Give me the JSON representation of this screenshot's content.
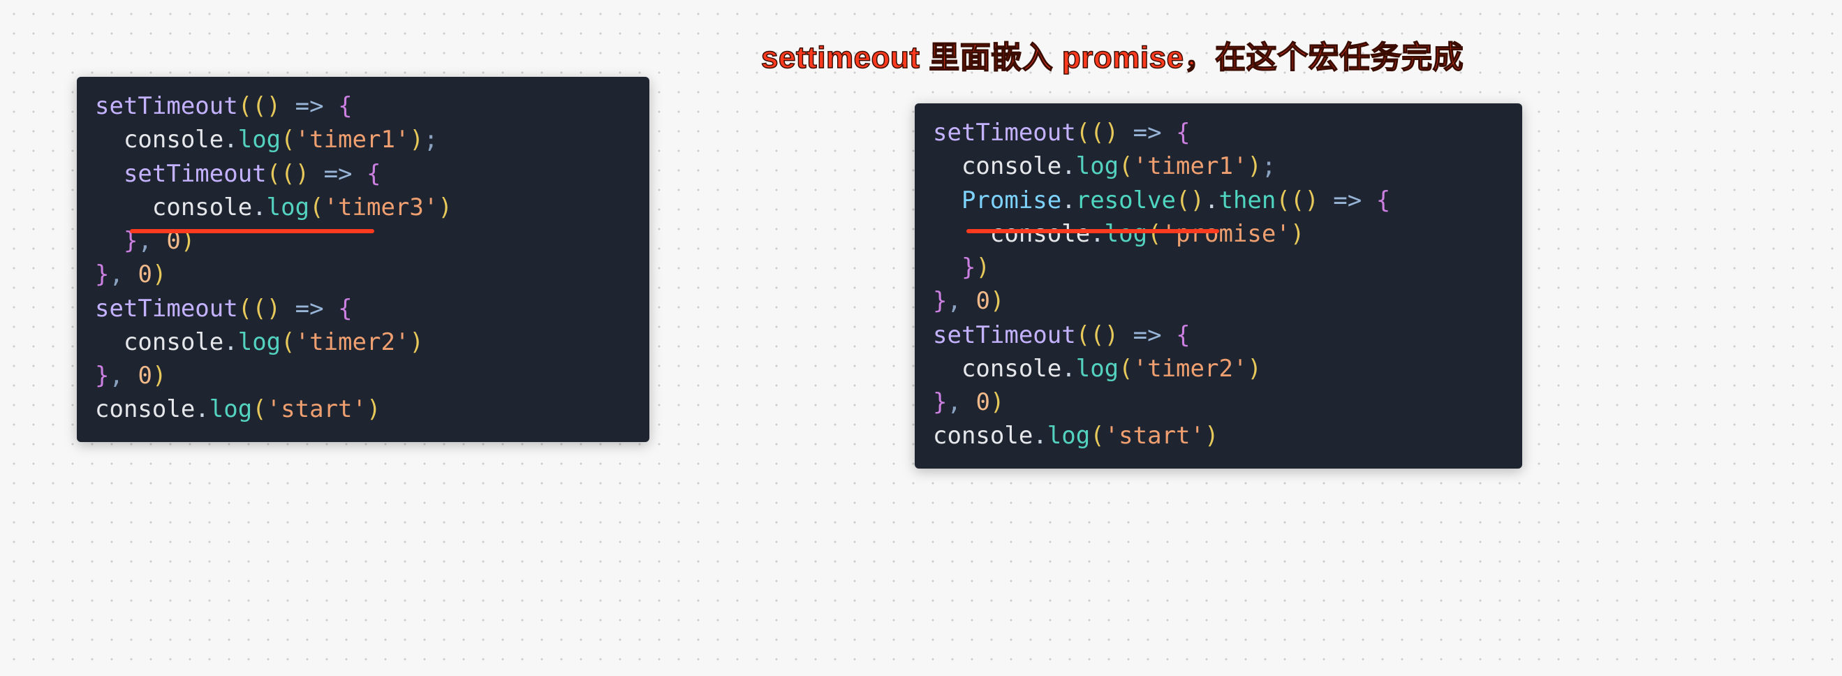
{
  "annotation": "settimeout 里面嵌入 promise，在这个宏任务完成",
  "left_code": {
    "lines": [
      [
        {
          "t": "setTimeout",
          "c": "fn"
        },
        {
          "t": "(",
          "c": "prn"
        },
        {
          "t": "()",
          "c": "prn"
        },
        {
          "t": " "
        },
        {
          "t": "=>",
          "c": "arw"
        },
        {
          "t": " "
        },
        {
          "t": "{",
          "c": "cb"
        }
      ],
      [
        {
          "t": "  "
        },
        {
          "t": "console",
          "c": "obj"
        },
        {
          "t": ".",
          "c": "dot"
        },
        {
          "t": "log",
          "c": "mtd"
        },
        {
          "t": "(",
          "c": "prn"
        },
        {
          "t": "'timer1'",
          "c": "str"
        },
        {
          "t": ")",
          "c": "prn"
        },
        {
          "t": ";",
          "c": "op"
        }
      ],
      [
        {
          "t": "  "
        },
        {
          "t": "setTimeout",
          "c": "fn"
        },
        {
          "t": "(",
          "c": "prn"
        },
        {
          "t": "()",
          "c": "prn"
        },
        {
          "t": " "
        },
        {
          "t": "=>",
          "c": "arw"
        },
        {
          "t": " "
        },
        {
          "t": "{",
          "c": "cb"
        }
      ],
      [
        {
          "t": "    "
        },
        {
          "t": "console",
          "c": "obj"
        },
        {
          "t": ".",
          "c": "dot"
        },
        {
          "t": "log",
          "c": "mtd"
        },
        {
          "t": "(",
          "c": "prn"
        },
        {
          "t": "'timer3'",
          "c": "str"
        },
        {
          "t": ")",
          "c": "prn"
        }
      ],
      [
        {
          "t": "  "
        },
        {
          "t": "}",
          "c": "cb"
        },
        {
          "t": ",",
          "c": "op"
        },
        {
          "t": " "
        },
        {
          "t": "0",
          "c": "num"
        },
        {
          "t": ")",
          "c": "prn"
        }
      ],
      [
        {
          "t": "}",
          "c": "cb"
        },
        {
          "t": ",",
          "c": "op"
        },
        {
          "t": " "
        },
        {
          "t": "0",
          "c": "num"
        },
        {
          "t": ")",
          "c": "prn"
        }
      ],
      [
        {
          "t": "setTimeout",
          "c": "fn"
        },
        {
          "t": "(",
          "c": "prn"
        },
        {
          "t": "()",
          "c": "prn"
        },
        {
          "t": " "
        },
        {
          "t": "=>",
          "c": "arw"
        },
        {
          "t": " "
        },
        {
          "t": "{",
          "c": "cb"
        }
      ],
      [
        {
          "t": "  "
        },
        {
          "t": "console",
          "c": "obj"
        },
        {
          "t": ".",
          "c": "dot"
        },
        {
          "t": "log",
          "c": "mtd"
        },
        {
          "t": "(",
          "c": "prn"
        },
        {
          "t": "'timer2'",
          "c": "str"
        },
        {
          "t": ")",
          "c": "prn"
        }
      ],
      [
        {
          "t": "}",
          "c": "cb"
        },
        {
          "t": ",",
          "c": "op"
        },
        {
          "t": " "
        },
        {
          "t": "0",
          "c": "num"
        },
        {
          "t": ")",
          "c": "prn"
        }
      ],
      [
        {
          "t": "console",
          "c": "obj"
        },
        {
          "t": ".",
          "c": "dot"
        },
        {
          "t": "log",
          "c": "mtd"
        },
        {
          "t": "(",
          "c": "prn"
        },
        {
          "t": "'start'",
          "c": "str"
        },
        {
          "t": ")",
          "c": "prn"
        }
      ]
    ]
  },
  "right_code": {
    "lines": [
      [
        {
          "t": "setTimeout",
          "c": "fn"
        },
        {
          "t": "(",
          "c": "prn"
        },
        {
          "t": "()",
          "c": "prn"
        },
        {
          "t": " "
        },
        {
          "t": "=>",
          "c": "arw"
        },
        {
          "t": " "
        },
        {
          "t": "{",
          "c": "cb"
        }
      ],
      [
        {
          "t": "  "
        },
        {
          "t": "console",
          "c": "obj"
        },
        {
          "t": ".",
          "c": "dot"
        },
        {
          "t": "log",
          "c": "mtd"
        },
        {
          "t": "(",
          "c": "prn"
        },
        {
          "t": "'timer1'",
          "c": "str"
        },
        {
          "t": ")",
          "c": "prn"
        },
        {
          "t": ";",
          "c": "op"
        }
      ],
      [
        {
          "t": "  "
        },
        {
          "t": "Promise",
          "c": "cls"
        },
        {
          "t": ".",
          "c": "dot"
        },
        {
          "t": "resolve",
          "c": "res"
        },
        {
          "t": "()",
          "c": "prn"
        },
        {
          "t": ".",
          "c": "dot"
        },
        {
          "t": "then",
          "c": "thn"
        },
        {
          "t": "(",
          "c": "prn"
        },
        {
          "t": "()",
          "c": "prn"
        },
        {
          "t": " "
        },
        {
          "t": "=>",
          "c": "arw"
        },
        {
          "t": " "
        },
        {
          "t": "{",
          "c": "cb"
        }
      ],
      [
        {
          "t": "    "
        },
        {
          "t": "console",
          "c": "obj"
        },
        {
          "t": ".",
          "c": "dot"
        },
        {
          "t": "log",
          "c": "mtd"
        },
        {
          "t": "(",
          "c": "prn"
        },
        {
          "t": "'promise'",
          "c": "str"
        },
        {
          "t": ")",
          "c": "prn"
        }
      ],
      [
        {
          "t": "  "
        },
        {
          "t": "}",
          "c": "cb"
        },
        {
          "t": ")",
          "c": "prn"
        }
      ],
      [
        {
          "t": "}",
          "c": "cb"
        },
        {
          "t": ",",
          "c": "op"
        },
        {
          "t": " "
        },
        {
          "t": "0",
          "c": "num"
        },
        {
          "t": ")",
          "c": "prn"
        }
      ],
      [
        {
          "t": "setTimeout",
          "c": "fn"
        },
        {
          "t": "(",
          "c": "prn"
        },
        {
          "t": "()",
          "c": "prn"
        },
        {
          "t": " "
        },
        {
          "t": "=>",
          "c": "arw"
        },
        {
          "t": " "
        },
        {
          "t": "{",
          "c": "cb"
        }
      ],
      [
        {
          "t": "  "
        },
        {
          "t": "console",
          "c": "obj"
        },
        {
          "t": ".",
          "c": "dot"
        },
        {
          "t": "log",
          "c": "mtd"
        },
        {
          "t": "(",
          "c": "prn"
        },
        {
          "t": "'timer2'",
          "c": "str"
        },
        {
          "t": ")",
          "c": "prn"
        }
      ],
      [
        {
          "t": "}",
          "c": "cb"
        },
        {
          "t": ",",
          "c": "op"
        },
        {
          "t": " "
        },
        {
          "t": "0",
          "c": "num"
        },
        {
          "t": ")",
          "c": "prn"
        }
      ],
      [
        {
          "t": "console",
          "c": "obj"
        },
        {
          "t": ".",
          "c": "dot"
        },
        {
          "t": "log",
          "c": "mtd"
        },
        {
          "t": "(",
          "c": "prn"
        },
        {
          "t": "'start'",
          "c": "str"
        },
        {
          "t": ")",
          "c": "prn"
        }
      ]
    ]
  }
}
